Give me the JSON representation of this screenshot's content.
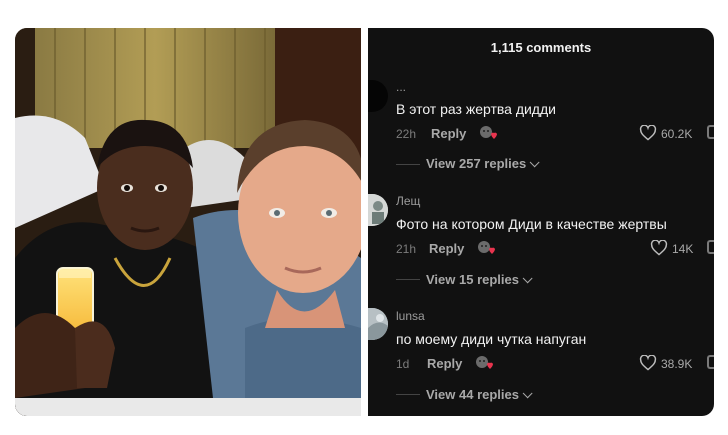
{
  "comments_header": "1,115 comments",
  "comments": [
    {
      "username": "...",
      "text": "В этот раз жертва дидди",
      "time": "22h",
      "reply_label": "Reply",
      "likes": "60.2K",
      "view_replies": "View 257 replies"
    },
    {
      "username": "Лещ",
      "text": "Фото на котором Диди в качестве жертвы",
      "time": "21h",
      "reply_label": "Reply",
      "likes": "14K",
      "view_replies": "View 15 replies"
    },
    {
      "username": "lunsa",
      "text": "по моему диди чутка напуган",
      "time": "1d",
      "reply_label": "Reply",
      "likes": "38.9K",
      "view_replies": "View 44 replies"
    }
  ],
  "colors": {
    "panel_bg": "#111111",
    "heart_accent": "#e8344e"
  },
  "icons": [
    "heart-icon",
    "chevron-down-icon",
    "reaction-badge-icon"
  ]
}
